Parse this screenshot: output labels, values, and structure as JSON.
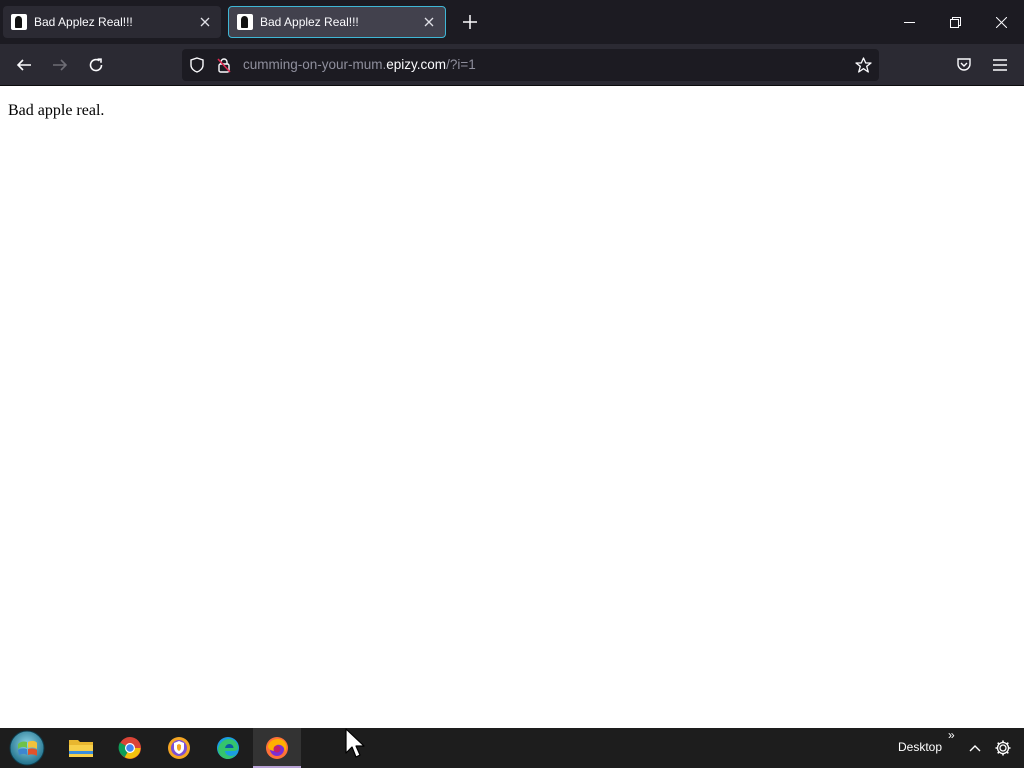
{
  "browser": {
    "tabs": [
      {
        "title": "Bad Applez Real!!!",
        "active": false
      },
      {
        "title": "Bad Applez Real!!!",
        "active": true
      }
    ],
    "new_tab_icon": "plus-icon",
    "window_controls": [
      "minimize-icon",
      "restore-icon",
      "close-icon"
    ]
  },
  "navbar": {
    "back_icon": "arrow-left-icon",
    "forward_icon": "arrow-right-icon",
    "reload_icon": "reload-icon",
    "url": {
      "prefix": "cumming-on-your-mum.",
      "domain": "epizy.com",
      "suffix": "/?i=1"
    },
    "bookmark_icon": "star-icon",
    "pocket_icon": "pocket-icon",
    "menu_icon": "hamburger-menu-icon"
  },
  "page": {
    "body_text": "Bad apple real."
  },
  "taskbar": {
    "apps": [
      "start-orb",
      "file-explorer",
      "chrome",
      "brave",
      "edge",
      "firefox"
    ],
    "active_app": "firefox",
    "desktop_label": "Desktop",
    "desktop_chevron": "»"
  },
  "colors": {
    "tabstrip_bg": "#1c1b22",
    "navbar_bg": "#2b2a33",
    "active_tab_border": "#3fb7d6",
    "taskbar_bg": "#1d1d1d"
  }
}
